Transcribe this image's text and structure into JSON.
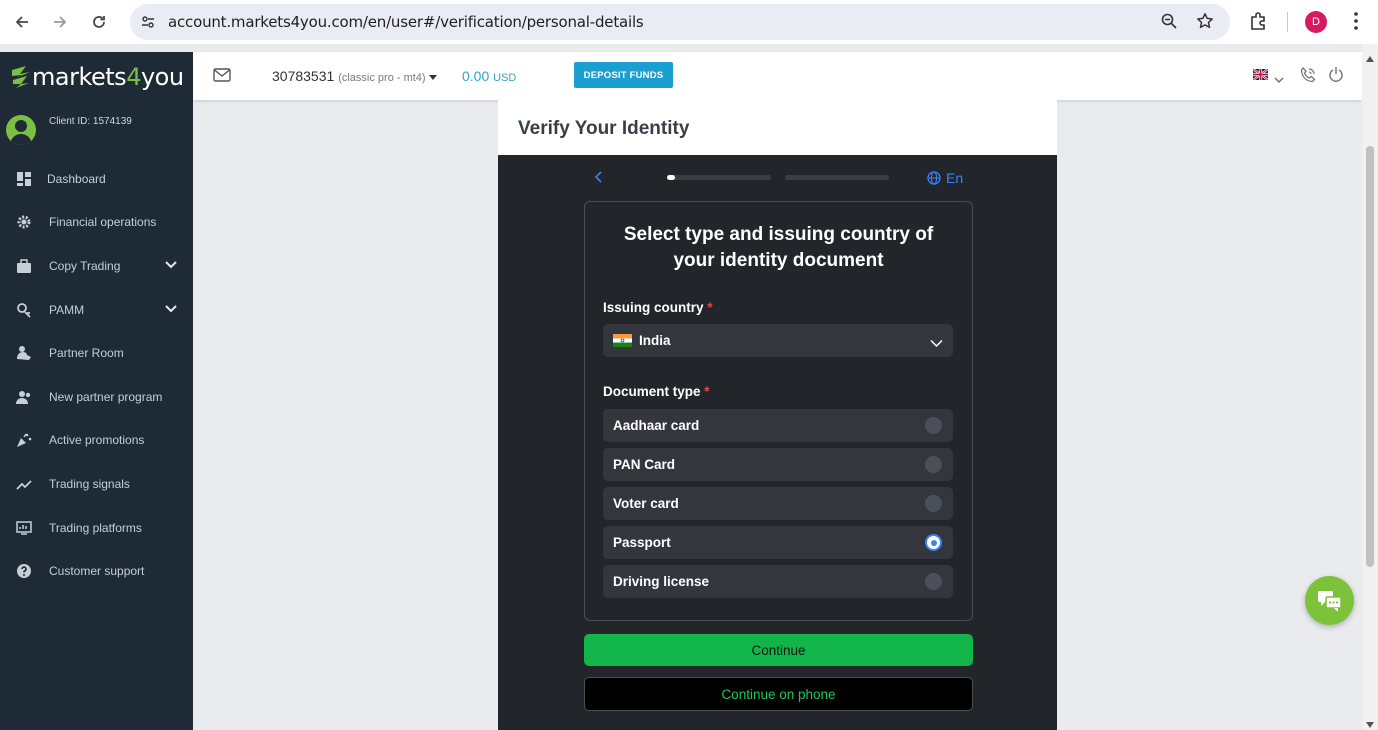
{
  "browser": {
    "url": "account.markets4you.com/en/user#/verification/personal-details",
    "profile_initial": "D"
  },
  "brand": {
    "logo_left": "markets",
    "logo_four": "4",
    "logo_right": "you",
    "accent": "#7bc043"
  },
  "sidebar": {
    "client_id": "Client ID: 1574139",
    "items": [
      {
        "label": "Dashboard",
        "icon": "dashboard-icon"
      },
      {
        "label": "Financial operations",
        "icon": "gear-icon"
      },
      {
        "label": "Copy Trading",
        "icon": "briefcase-icon"
      },
      {
        "label": "PAMM",
        "icon": "pamm-icon"
      },
      {
        "label": "Partner Room",
        "icon": "partner-icon"
      },
      {
        "label": "New partner program",
        "icon": "people-icon"
      },
      {
        "label": "Active promotions",
        "icon": "promotion-icon"
      },
      {
        "label": "Trading signals",
        "icon": "trend-icon"
      },
      {
        "label": "Trading platforms",
        "icon": "platform-icon"
      },
      {
        "label": "Customer support",
        "icon": "help-icon"
      }
    ]
  },
  "header": {
    "account_number": "30783531",
    "account_type": "(classic pro - mt4)",
    "balance": "0.00",
    "currency": "USD",
    "deposit_label": "DEPOSIT FUNDS"
  },
  "verify": {
    "title": "Verify Your Identity",
    "language": "En",
    "heading": "Select type and issuing country of your identity document",
    "country_label": "Issuing country",
    "country_value": "India",
    "doc_label": "Document type",
    "required_mark": "*",
    "documents": [
      {
        "label": "Aadhaar card",
        "selected": false
      },
      {
        "label": "PAN Card",
        "selected": false
      },
      {
        "label": "Voter card",
        "selected": false
      },
      {
        "label": "Passport",
        "selected": true
      },
      {
        "label": "Driving license",
        "selected": false
      }
    ],
    "continue_label": "Continue",
    "continue_phone_label": "Continue on phone",
    "progress_step": 1,
    "progress_total": 2
  }
}
